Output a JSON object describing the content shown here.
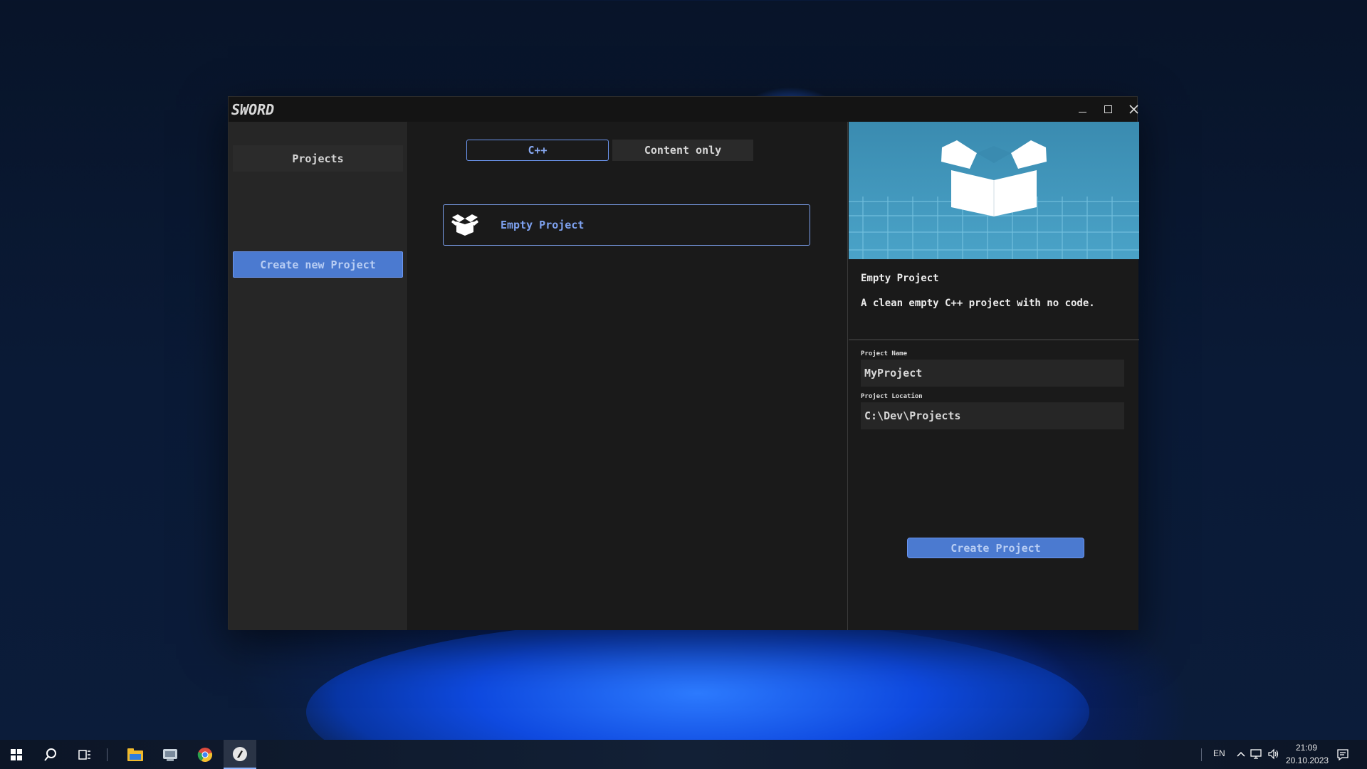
{
  "window": {
    "logo_text": "SWORD",
    "controls": {
      "minimize_icon": "minimize-icon",
      "maximize_icon": "maximize-icon",
      "close_icon": "close-icon"
    }
  },
  "sidebar": {
    "projects_label": "Projects",
    "create_new_label": "Create new Project"
  },
  "tabs": [
    {
      "label": "C++",
      "selected": true
    },
    {
      "label": "Content only",
      "selected": false
    }
  ],
  "templates": [
    {
      "name": "Empty Project",
      "icon": "open-box-icon",
      "selected": true
    }
  ],
  "details": {
    "title": "Empty Project",
    "description": "A clean empty C++ project with no code.",
    "project_name_label": "Project Name",
    "project_name_value": "MyProject",
    "project_location_label": "Project Location",
    "project_location_value": "C:\\Dev\\Projects",
    "create_button": "Create Project"
  },
  "taskbar": {
    "language": "EN",
    "time": "21:09",
    "date": "20.10.2023",
    "icons": [
      "windows-start-icon",
      "search-icon",
      "task-view-icon",
      "file-explorer-icon",
      "app-icon",
      "chrome-icon",
      "sword-app-icon"
    ]
  },
  "colors": {
    "accent": "#4b7ad0",
    "accent_border": "#6b95ee",
    "panel_bg": "#262626",
    "main_bg": "#1a1a1a",
    "preview_bg": "#3a8bb0"
  }
}
